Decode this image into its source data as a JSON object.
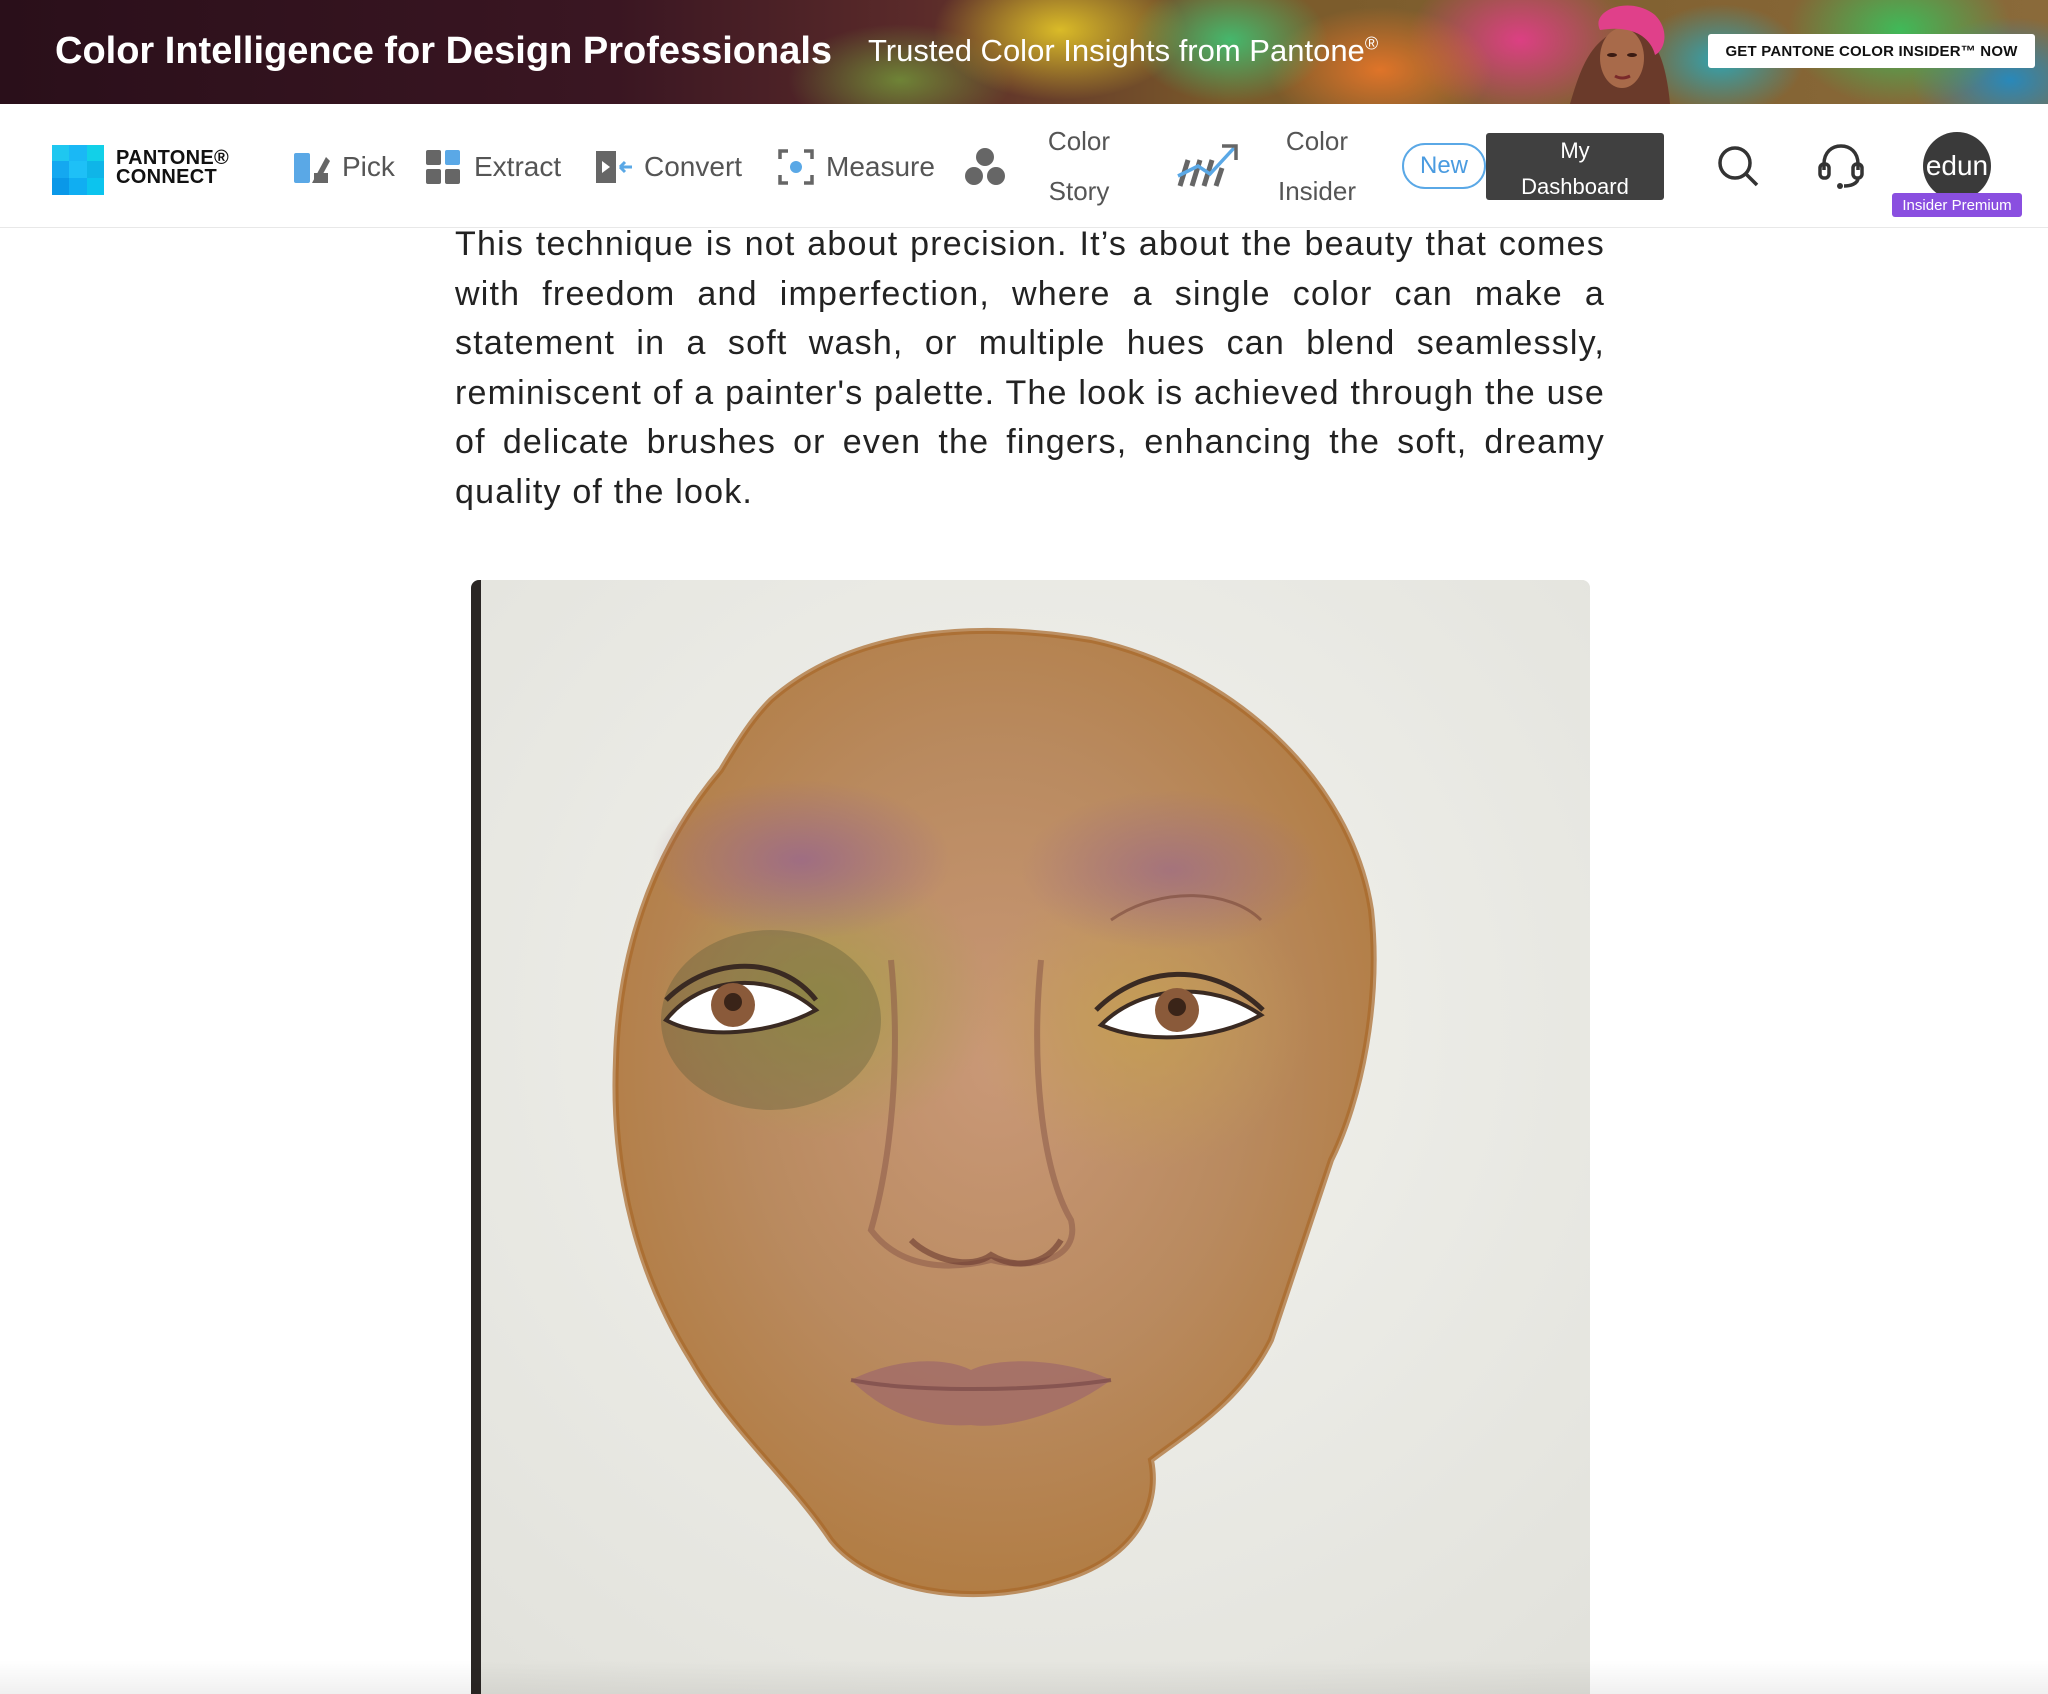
{
  "banner": {
    "title": "Color Intelligence for Design Professionals",
    "subtitle": "Trusted Color Insights from Pantone",
    "subtitle_mark": "®",
    "cta": "GET PANTONE COLOR INSIDER™ NOW"
  },
  "nav": {
    "logo_line1": "PANTONE®",
    "logo_line2": "CONNECT",
    "items": [
      {
        "label": "Pick",
        "icon": "pick-icon"
      },
      {
        "label": "Extract",
        "icon": "extract-icon"
      },
      {
        "label": "Convert",
        "icon": "convert-icon"
      },
      {
        "label": "Measure",
        "icon": "measure-icon"
      }
    ],
    "color_story": {
      "line1": "Color",
      "line2": "Story",
      "icon": "color-story-icon"
    },
    "color_insider": {
      "line1": "Color",
      "line2": "Insider",
      "icon": "trend-chart-icon"
    },
    "new_badge": "New",
    "dashboard": {
      "line1": "My",
      "line2": "Dashboard"
    },
    "search_icon": "search-icon",
    "support_icon": "headset-icon",
    "avatar_text": "edun",
    "premium_badge": "Insider Premium"
  },
  "article": {
    "paragraph": "This technique is not about precision. It’s about the beauty that comes with freedom and imperfection, where a single color can make a statement in a soft wash, or multiple hues can blend seamlessly, reminiscent of a painter's palette. The look is achieved through the use of delicate brushes or even the fingers, enhancing the soft, dreamy quality of the look."
  },
  "colors": {
    "accent_blue": "#4a9be0",
    "dashboard_bg": "#404040",
    "premium_purple": "#8a4fe0"
  }
}
